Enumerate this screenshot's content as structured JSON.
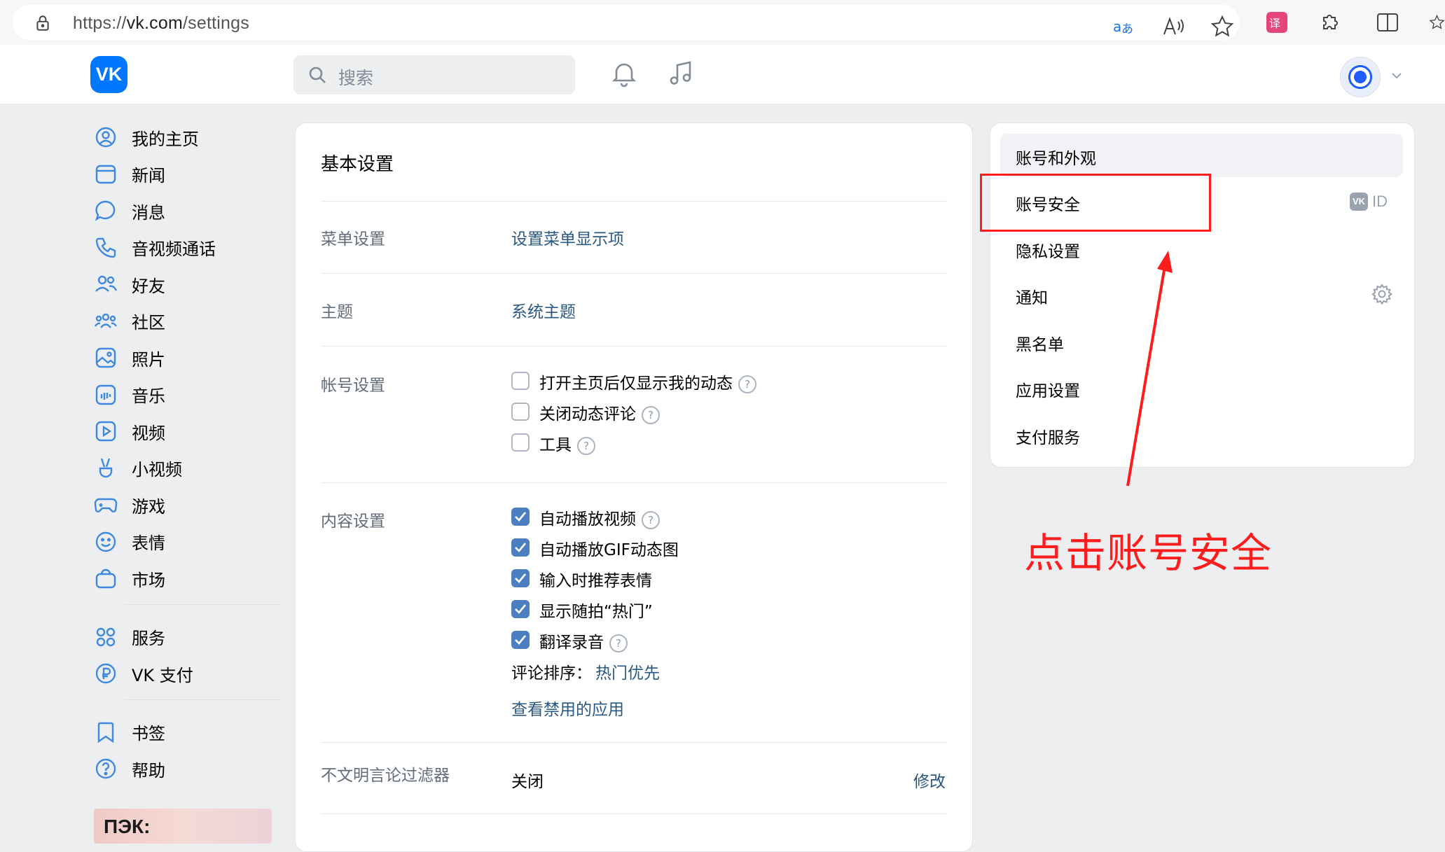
{
  "browser": {
    "url_scheme": "https://",
    "url_host": "vk.com",
    "url_path": "/settings",
    "toolbar_icons": [
      "translate-icon",
      "read-aloud-icon",
      "favorite-star-icon",
      "ext-icon",
      "extensions-icon",
      "split-screen-icon"
    ]
  },
  "header": {
    "logo": "VK",
    "search_placeholder": "搜索"
  },
  "left_nav": {
    "group1": [
      {
        "label": "我的主页",
        "icon": "profile-icon"
      },
      {
        "label": "新闻",
        "icon": "news-icon"
      },
      {
        "label": "消息",
        "icon": "messages-icon"
      },
      {
        "label": "音视频通话",
        "icon": "phone-icon"
      },
      {
        "label": "好友",
        "icon": "friends-icon"
      },
      {
        "label": "社区",
        "icon": "communities-icon"
      },
      {
        "label": "照片",
        "icon": "photos-icon"
      },
      {
        "label": "音乐",
        "icon": "music-icon"
      },
      {
        "label": "视频",
        "icon": "video-icon"
      },
      {
        "label": "小视频",
        "icon": "clips-icon"
      },
      {
        "label": "游戏",
        "icon": "games-icon"
      },
      {
        "label": "表情",
        "icon": "stickers-icon"
      },
      {
        "label": "市场",
        "icon": "market-icon"
      }
    ],
    "group2": [
      {
        "label": "服务",
        "icon": "services-icon"
      },
      {
        "label": "VK 支付",
        "icon": "vkpay-icon"
      }
    ],
    "group3": [
      {
        "label": "书签",
        "icon": "bookmark-icon"
      },
      {
        "label": "帮助",
        "icon": "help-icon"
      }
    ],
    "promo_text": "ПЭК:"
  },
  "main": {
    "title": "基本设置",
    "menu_settings": {
      "label": "菜单设置",
      "link": "设置菜单显示项"
    },
    "theme": {
      "label": "主题",
      "link": "系统主题"
    },
    "account": {
      "label": "帐号设置",
      "options": [
        {
          "text": "打开主页后仅显示我的动态",
          "checked": false,
          "help": true
        },
        {
          "text": "关闭动态评论",
          "checked": false,
          "help": true
        },
        {
          "text": "工具",
          "checked": false,
          "help": true
        }
      ]
    },
    "content": {
      "label": "内容设置",
      "options": [
        {
          "text": "自动播放视频",
          "checked": true,
          "help": true
        },
        {
          "text": "自动播放GIF动态图",
          "checked": true,
          "help": false
        },
        {
          "text": "输入时推荐表情",
          "checked": true,
          "help": false
        },
        {
          "text": "显示随拍“热门”",
          "checked": true,
          "help": false
        },
        {
          "text": "翻译录音",
          "checked": true,
          "help": true
        }
      ],
      "comment_sort_label": "评论排序：",
      "comment_sort_value": "热门优先",
      "blocked_apps_link": "查看禁用的应用"
    },
    "filter": {
      "label": "不文明言论过滤器",
      "value": "关闭",
      "action": "修改"
    }
  },
  "right_menu": {
    "items": [
      {
        "label": "账号和外观",
        "selected": true
      },
      {
        "label": "账号安全",
        "badge": "ID",
        "badge_logo": "VK"
      },
      {
        "label": "隐私设置"
      },
      {
        "label": "通知",
        "icon": "gear-icon"
      },
      {
        "label": "黑名单"
      },
      {
        "label": "应用设置"
      },
      {
        "label": "支付服务"
      }
    ]
  },
  "annotation": {
    "text": "点击账号安全",
    "color": "#ff1c1c"
  },
  "colors": {
    "accent": "#0077ff",
    "link": "#2a5885",
    "checkbox": "#4b7fbf",
    "page_bg": "#edeef0"
  }
}
